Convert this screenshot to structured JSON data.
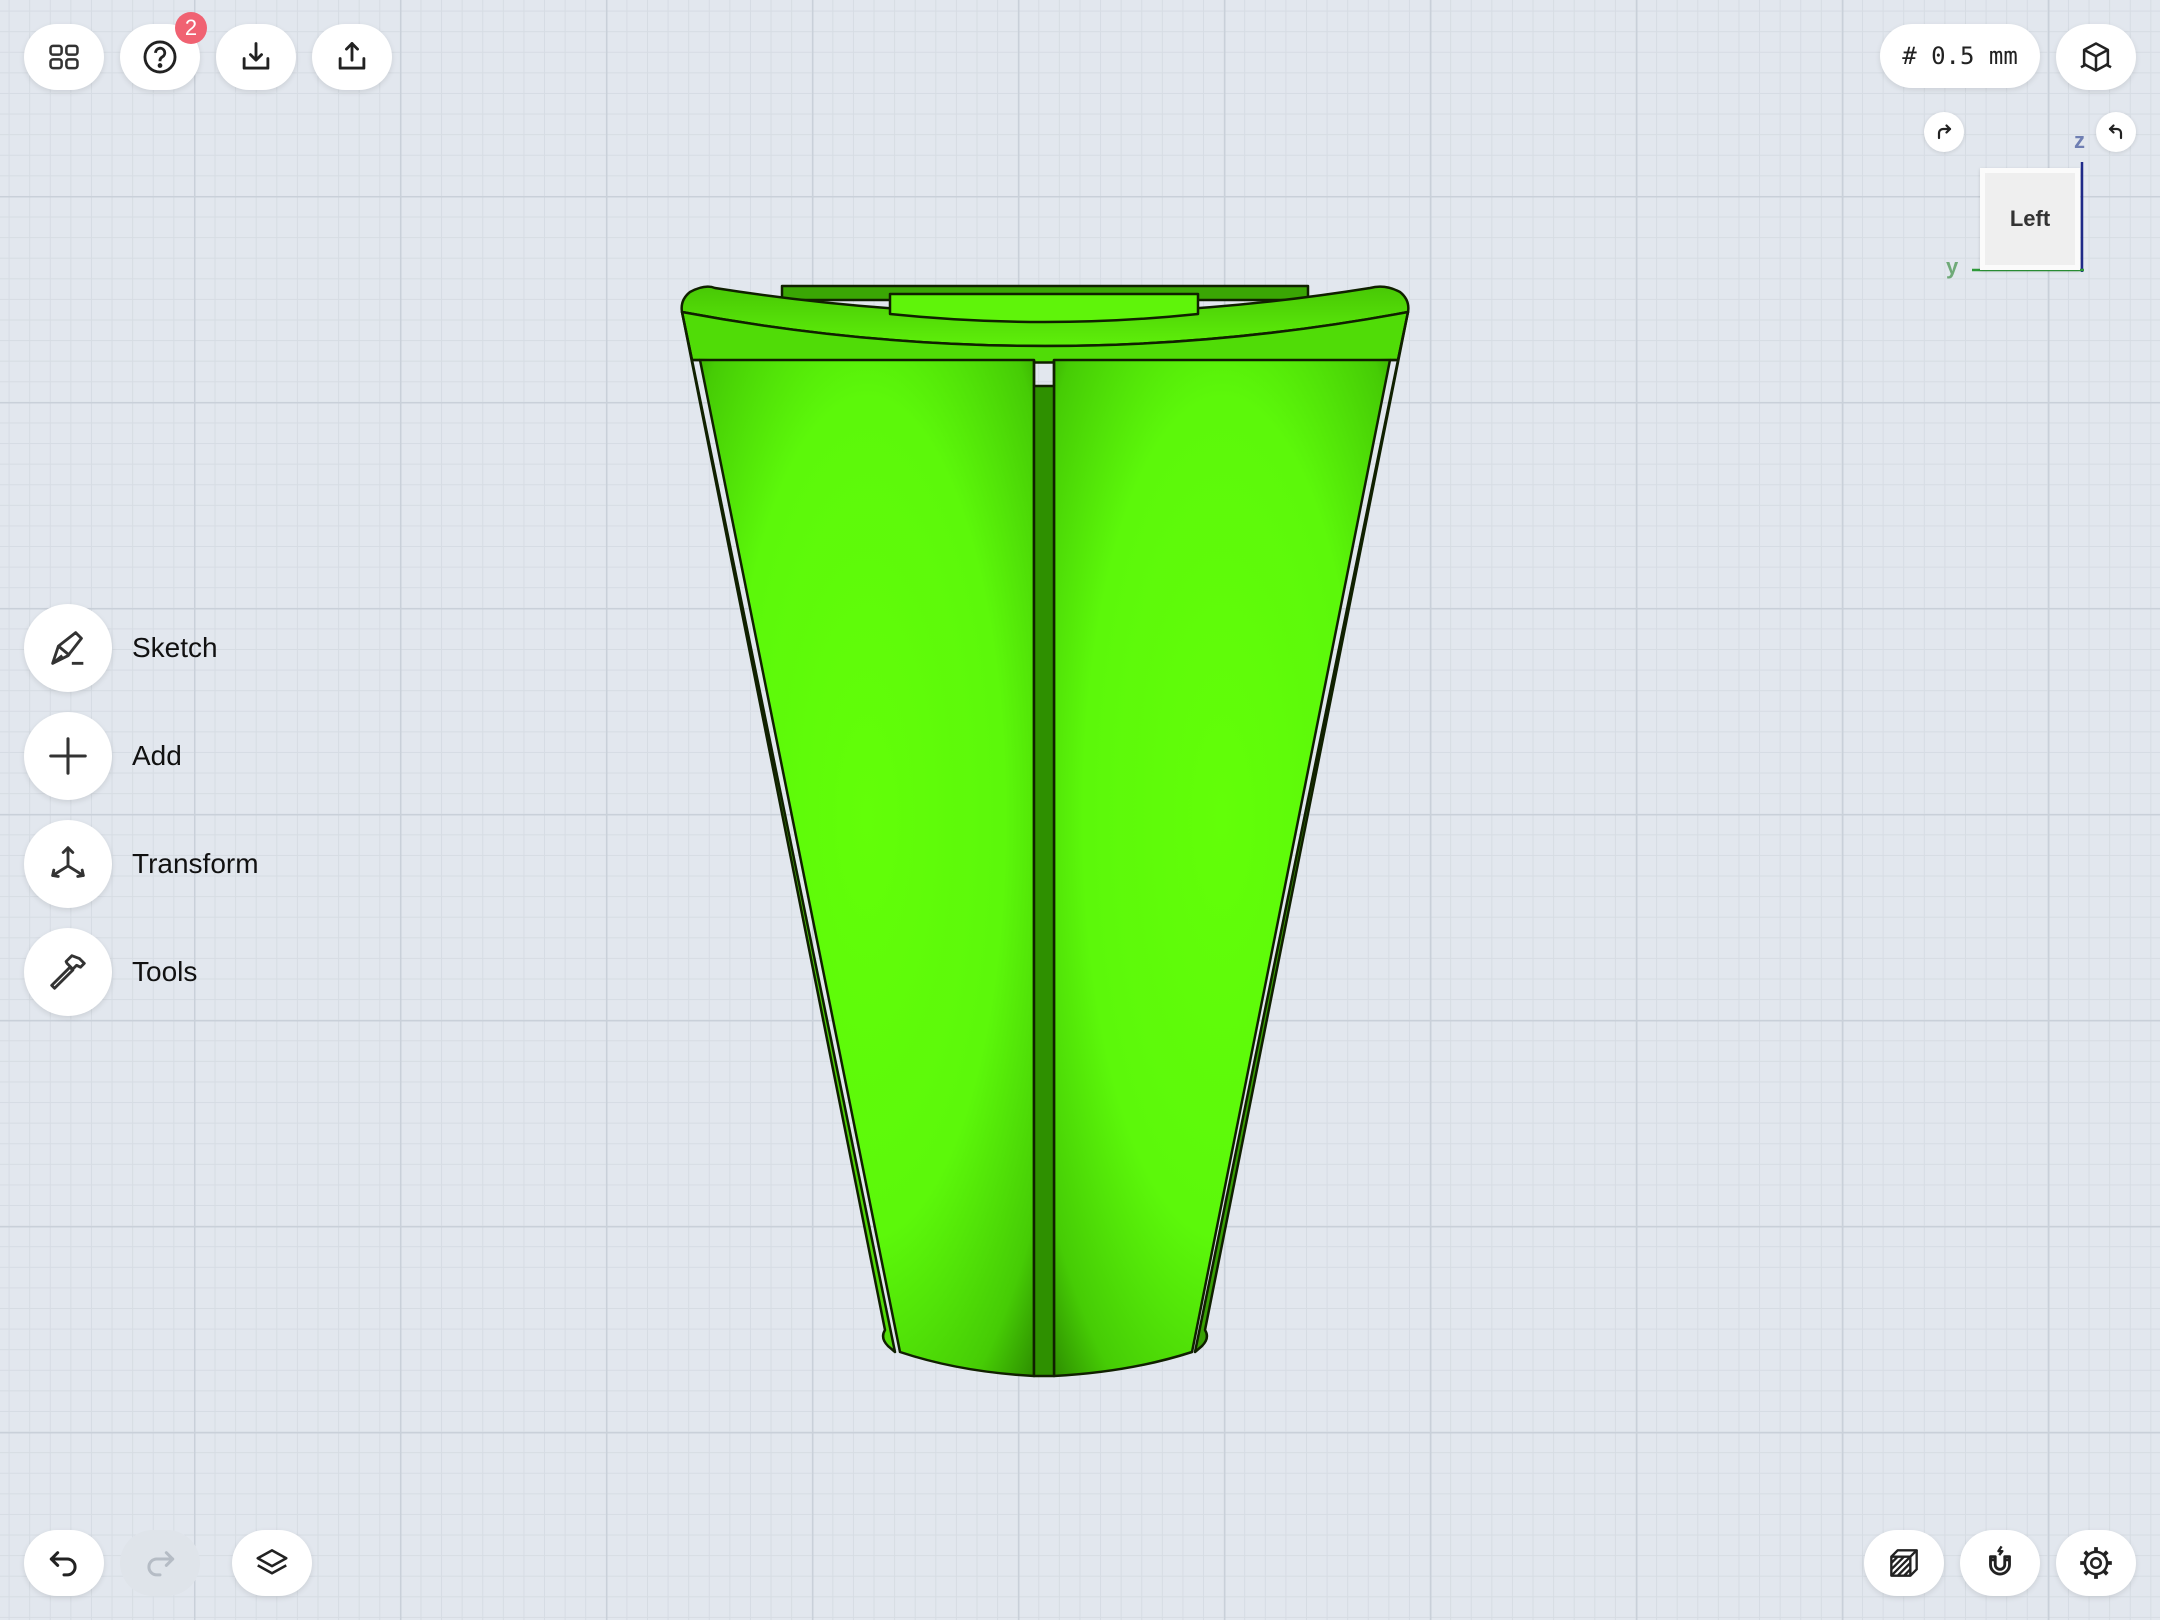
{
  "toolbar": {
    "help_badge_count": "2",
    "grid_size": "# 0.5 mm"
  },
  "icons": {
    "grid": "grid-icon",
    "help": "help-icon",
    "import": "import-icon",
    "export": "export-icon",
    "view_cube": "view-cube-icon",
    "sketch": "sketch-icon",
    "add": "plus-icon",
    "transform": "transform-icon",
    "tools": "hammer-icon",
    "undo": "undo-icon",
    "redo": "redo-icon",
    "layers": "layers-icon",
    "display_mode": "shaded-box-icon",
    "snap": "magnet-icon",
    "settings": "gear-icon"
  },
  "side_menu": {
    "items": [
      {
        "label": "Sketch"
      },
      {
        "label": "Add"
      },
      {
        "label": "Transform"
      },
      {
        "label": "Tools"
      }
    ]
  },
  "view_cube": {
    "face_label": "Left",
    "axis_z": "z",
    "axis_y": "y",
    "colors": {
      "z": "#1f2a8a",
      "y": "#2f9a3a"
    }
  },
  "model": {
    "color": "#5fff0a",
    "shade_color": "#2c8a00"
  },
  "redo_enabled": false
}
